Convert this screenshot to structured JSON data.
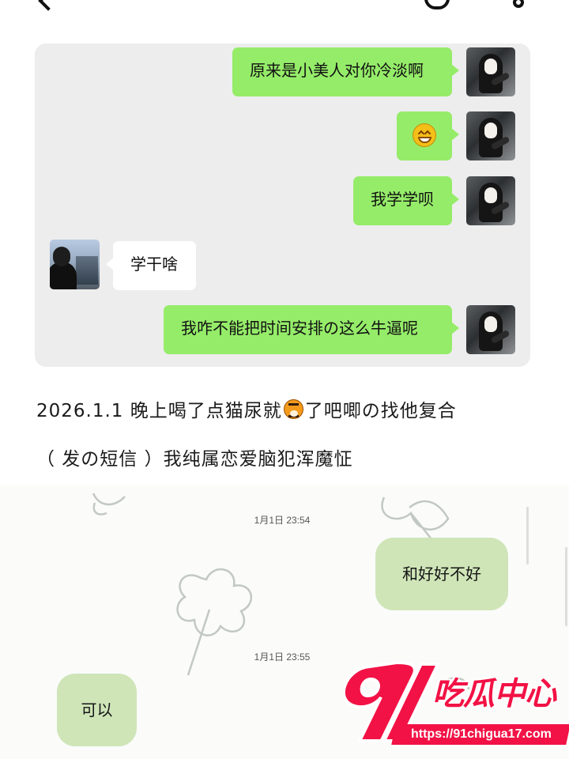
{
  "top_conversation": {
    "messages": [
      {
        "side": "self",
        "text": "原来是小美人对你冷淡啊"
      },
      {
        "side": "self",
        "emoji": "grinning-emoji"
      },
      {
        "side": "self",
        "text": "我学学呗"
      },
      {
        "side": "other",
        "text": "学干啥"
      },
      {
        "side": "self",
        "text": "我咋不能把时间安排の这么牛逼呢"
      }
    ]
  },
  "caption": {
    "line1_before_emoji": "2026.1.1 晚上喝了点猫尿就",
    "line1_emoji": "tiger-face-emoji",
    "line1_after_emoji": "了吧唧の找他复合",
    "line2": "（ 发の短信 ）我纯属恋爱脑犯浑魔怔"
  },
  "bottom_conversation": {
    "timestamps": [
      "1月1日 23:54",
      "1月1日 23:55"
    ],
    "messages": [
      {
        "side": "self",
        "text": "和好好不好"
      },
      {
        "side": "other",
        "text": "可以"
      }
    ]
  },
  "watermark": {
    "number": "91",
    "label": "吃瓜中心",
    "url": "https://91chigua17.com"
  },
  "colors": {
    "sent_bubble": "#95ec69",
    "received_bubble": "#ffffff",
    "chat_background": "#ededed",
    "sms_bubble": "#cfe5b8",
    "watermark": "#f21245"
  }
}
